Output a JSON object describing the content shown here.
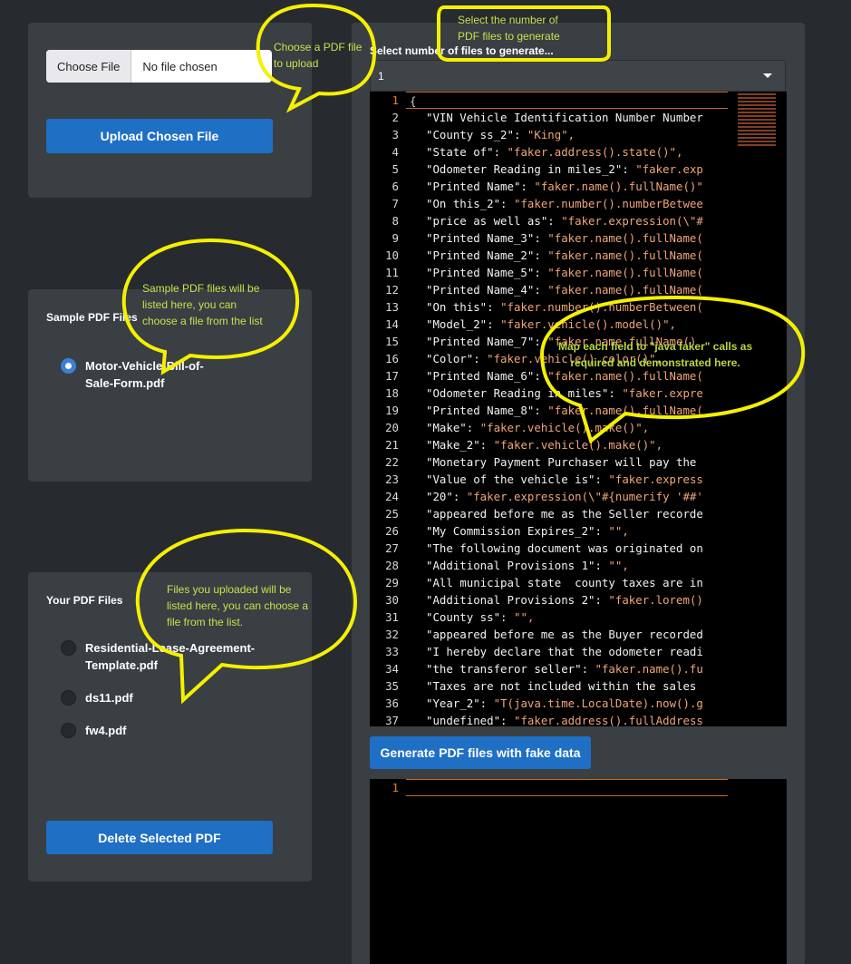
{
  "upload": {
    "choose_label": "Choose File",
    "file_status": "No file chosen",
    "upload_button": "Upload Chosen File"
  },
  "sample": {
    "title": "Sample PDF Files",
    "items": [
      {
        "label": "Motor-Vehicle-Bill-of-Sale-Form.pdf",
        "checked": true
      }
    ]
  },
  "yours": {
    "title": "Your PDF Files",
    "items": [
      {
        "label": "Residential-Lease-Agreement-Template.pdf"
      },
      {
        "label": "ds11.pdf"
      },
      {
        "label": "fw4.pdf"
      }
    ],
    "delete_button": "Delete Selected PDF"
  },
  "generator": {
    "select_label": "Select number of files to generate...",
    "select_value": "1",
    "generate_button": "Generate PDF files with fake data",
    "editor_lines": [
      [
        "{",
        ""
      ],
      [
        "\"VIN Vehicle Identification Number Number",
        ""
      ],
      [
        "\"County ss_2\": ",
        "\"King\","
      ],
      [
        "\"State of\": ",
        "\"faker.address().state()\","
      ],
      [
        "\"Odometer Reading in miles_2\": ",
        "\"faker.exp"
      ],
      [
        "\"Printed Name\": ",
        "\"faker.name().fullName()\""
      ],
      [
        "\"On this_2\": ",
        "\"faker.number().numberBetwee"
      ],
      [
        "\"price as well as\": ",
        "\"faker.expression(\\\"#"
      ],
      [
        "\"Printed Name_3\": ",
        "\"faker.name().fullName("
      ],
      [
        "\"Printed Name_2\": ",
        "\"faker.name().fullName("
      ],
      [
        "\"Printed Name_5\": ",
        "\"faker.name().fullName("
      ],
      [
        "\"Printed Name_4\": ",
        "\"faker.name().fullName("
      ],
      [
        "\"On this\": ",
        "\"faker.number().numberBetween("
      ],
      [
        "\"Model_2\": ",
        "\"faker.vehicle().model()\","
      ],
      [
        "\"Printed Name_7\": ",
        "\"faker.name.fullName()"
      ],
      [
        "\"Color\": ",
        "\"faker.vehicle().color()\","
      ],
      [
        "\"Printed Name_6\": ",
        "\"faker.name().fullName("
      ],
      [
        "\"Odometer Reading in miles\": ",
        "\"faker.expre"
      ],
      [
        "\"Printed Name_8\": ",
        "\"faker.name().fullName("
      ],
      [
        "\"Make\": ",
        "\"faker.vehicle().make()\","
      ],
      [
        "\"Make_2\": ",
        "\"faker.vehicle().make()\","
      ],
      [
        "\"Monetary Payment Purchaser will pay the",
        ""
      ],
      [
        "\"Value of the vehicle is\": ",
        "\"faker.express"
      ],
      [
        "\"20\": ",
        "\"faker.expression(\\\"#{numerify '##'"
      ],
      [
        "\"appeared before me as the Seller recorde",
        ""
      ],
      [
        "\"My Commission Expires_2\": ",
        "\"\","
      ],
      [
        "\"The following document was originated on",
        ""
      ],
      [
        "\"Additional Provisions 1\": ",
        "\"\","
      ],
      [
        "\"All municipal state  county taxes are in",
        ""
      ],
      [
        "\"Additional Provisions 2\": ",
        "\"faker.lorem()"
      ],
      [
        "\"County ss\": ",
        "\"\","
      ],
      [
        "\"appeared before me as the Buyer recorded",
        ""
      ],
      [
        "\"I hereby declare that the odometer readi",
        ""
      ],
      [
        "\"the transferor seller\": ",
        "\"faker.name().fu"
      ],
      [
        "\"Taxes are not included within the sales",
        ""
      ],
      [
        "\"Year_2\": ",
        "\"T(java.time.LocalDate).now().g"
      ],
      [
        "\"undefined\": ",
        "\"faker.address().fullAddress"
      ]
    ],
    "output_lines": [
      "1"
    ]
  },
  "callouts": {
    "choose": "Choose a PDF file\nto upload",
    "select": "Select the number of\nPDF files to generate",
    "sample": "Sample PDF files will be\nlisted here, you can\nchoose a file from the list",
    "map": "Map each field to \"java faker\" calls as\nrequired and demonstrated here.",
    "yours": "Files you uploaded will be\nlisted here, you can choose a\nfile from the list."
  },
  "colors": {
    "background": "#272b30",
    "panel": "#3a3f44",
    "button": "#1f6fc5",
    "callout_outline": "#f5f000",
    "callout_text": "#c9e04a",
    "string_orange": "#f0a57a"
  }
}
